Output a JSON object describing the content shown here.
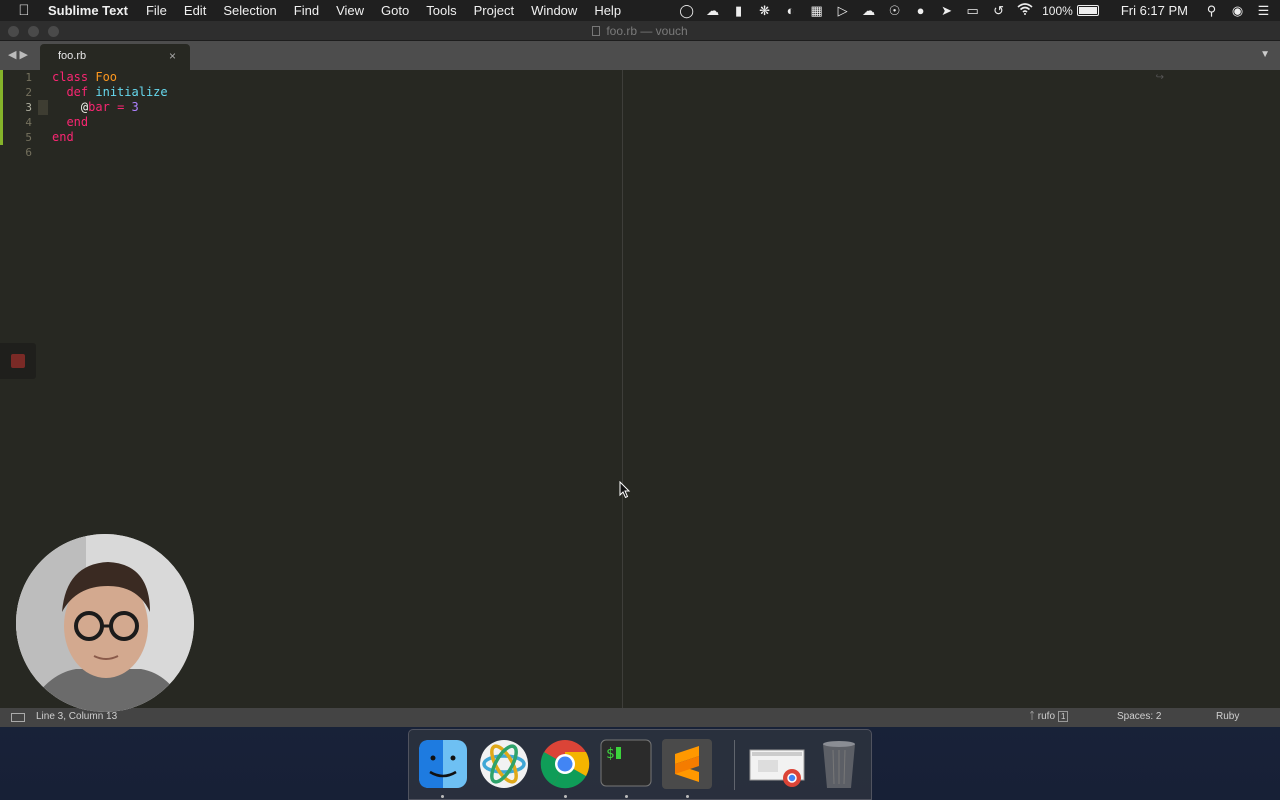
{
  "menubar": {
    "app_name": "Sublime Text",
    "menus": [
      "File",
      "Edit",
      "Selection",
      "Find",
      "View",
      "Goto",
      "Tools",
      "Project",
      "Window",
      "Help"
    ],
    "battery_percent": "100%",
    "clock": "Fri 6:17 PM",
    "status_icons": [
      "creative-cloud-icon",
      "cloud-upload-icon",
      "bookmark-icon",
      "peacock-icon",
      "half-circle-icon",
      "grid-icon",
      "video-icon",
      "cloud-icon",
      "onepassword-icon",
      "elephant-icon",
      "rocket-icon",
      "airplay-icon",
      "time-machine-icon",
      "wifi-icon"
    ]
  },
  "window": {
    "title": "foo.rb — vouch",
    "tab": {
      "label": "foo.rb"
    }
  },
  "editor": {
    "line_numbers": [
      "1",
      "2",
      "3",
      "4",
      "5",
      "6"
    ],
    "active_line": 3,
    "code": {
      "l1_kw": "class",
      "l1_cls": "Foo",
      "l2_kw": "def",
      "l2_fn": "initialize",
      "l3_at": "@",
      "l3_ivar": "bar",
      "l3_op": "=",
      "l3_num": "3",
      "l4_kw": "end",
      "l5_kw": "end"
    },
    "colors": {
      "background": "#272822",
      "keyword": "#f92672",
      "class": "#fd971f",
      "function": "#66d9ef",
      "number": "#ae81ff"
    }
  },
  "statusbar": {
    "position": "Line 3, Column 13",
    "formatter": "rufo",
    "formatter_badge": "1",
    "indentation": "Spaces: 2",
    "syntax": "Ruby"
  },
  "dock": {
    "apps": [
      "finder",
      "atom-orbit",
      "chrome",
      "terminal",
      "sublime-text",
      "chrome-window-preview",
      "trash"
    ]
  }
}
